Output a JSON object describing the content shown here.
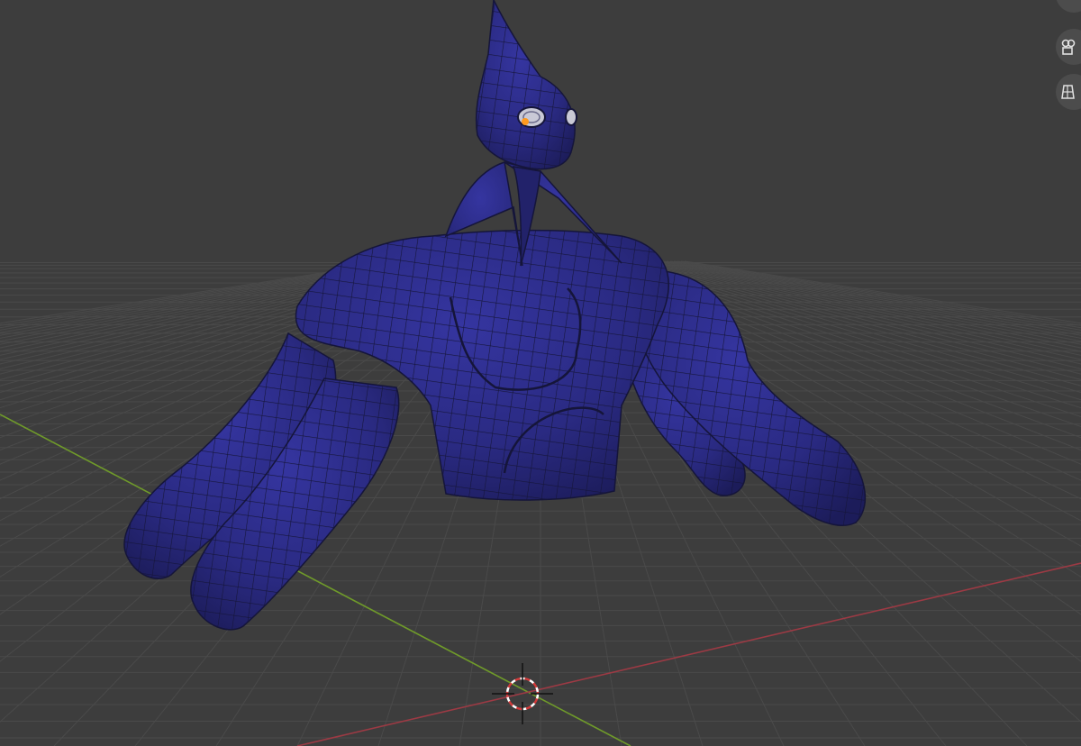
{
  "viewport": {
    "background": "#3d3d3d",
    "grid_color": "#4a4a4a",
    "x_axis_color": "#9c3a44",
    "y_axis_color": "#6f9a2a"
  },
  "object": {
    "mesh_color": "#2b2b80",
    "wire_color": "#15153a",
    "origin_color": "#ff9a1f"
  },
  "navigation_gizmo": {
    "buttons": [
      {
        "icon": "move-view-icon"
      },
      {
        "icon": "camera-view-icon"
      },
      {
        "icon": "perspective-toggle-icon"
      }
    ]
  }
}
